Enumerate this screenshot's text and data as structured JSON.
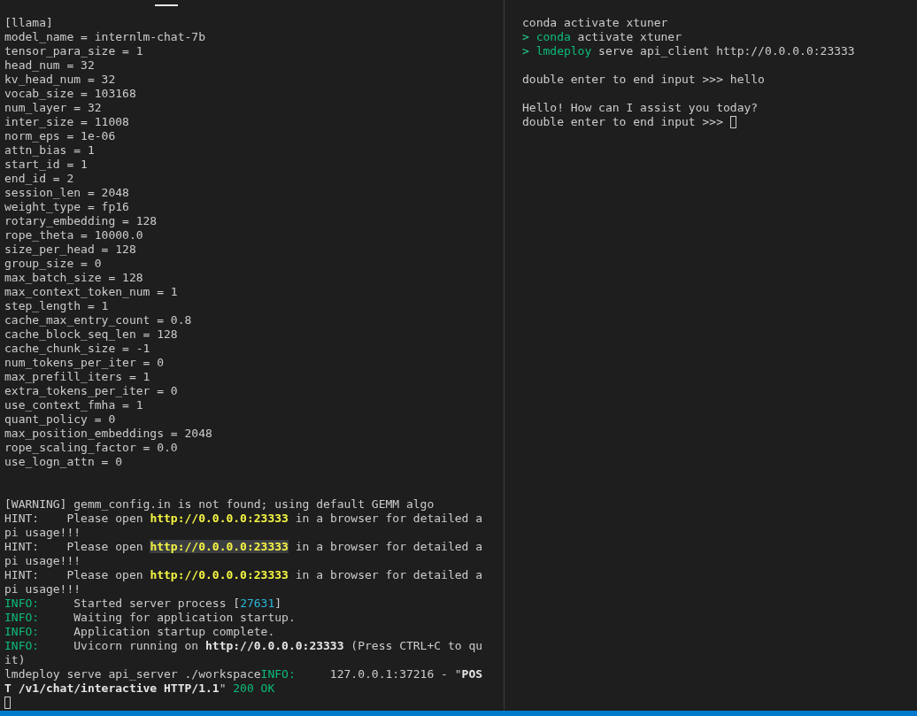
{
  "panes": [
    {
      "active_tab_indicator": true,
      "lines": [
        {
          "kind": "text",
          "segments": [
            {
              "text": "[llama]",
              "kind": "plain"
            }
          ]
        },
        {
          "kind": "text",
          "segments": [
            {
              "text": "model_name = internlm-chat-7b",
              "kind": "plain"
            }
          ]
        },
        {
          "kind": "text",
          "segments": [
            {
              "text": "tensor_para_size = 1",
              "kind": "plain"
            }
          ]
        },
        {
          "kind": "text",
          "segments": [
            {
              "text": "head_num = 32",
              "kind": "plain"
            }
          ]
        },
        {
          "kind": "text",
          "segments": [
            {
              "text": "kv_head_num = 32",
              "kind": "plain"
            }
          ]
        },
        {
          "kind": "text",
          "segments": [
            {
              "text": "vocab_size = 103168",
              "kind": "plain"
            }
          ]
        },
        {
          "kind": "text",
          "segments": [
            {
              "text": "num_layer = 32",
              "kind": "plain"
            }
          ]
        },
        {
          "kind": "text",
          "segments": [
            {
              "text": "inter_size = 11008",
              "kind": "plain"
            }
          ]
        },
        {
          "kind": "text",
          "segments": [
            {
              "text": "norm_eps = 1e-06",
              "kind": "plain"
            }
          ]
        },
        {
          "kind": "text",
          "segments": [
            {
              "text": "attn_bias = 1",
              "kind": "plain"
            }
          ]
        },
        {
          "kind": "text",
          "segments": [
            {
              "text": "start_id = 1",
              "kind": "plain"
            }
          ]
        },
        {
          "kind": "text",
          "segments": [
            {
              "text": "end_id = 2",
              "kind": "plain"
            }
          ]
        },
        {
          "kind": "text",
          "segments": [
            {
              "text": "session_len = 2048",
              "kind": "plain"
            }
          ]
        },
        {
          "kind": "text",
          "segments": [
            {
              "text": "weight_type = fp16",
              "kind": "plain"
            }
          ]
        },
        {
          "kind": "text",
          "segments": [
            {
              "text": "rotary_embedding = 128",
              "kind": "plain"
            }
          ]
        },
        {
          "kind": "text",
          "segments": [
            {
              "text": "rope_theta = 10000.0",
              "kind": "plain"
            }
          ]
        },
        {
          "kind": "text",
          "segments": [
            {
              "text": "size_per_head = 128",
              "kind": "plain"
            }
          ]
        },
        {
          "kind": "text",
          "segments": [
            {
              "text": "group_size = 0",
              "kind": "plain"
            }
          ]
        },
        {
          "kind": "text",
          "segments": [
            {
              "text": "max_batch_size = 128",
              "kind": "plain"
            }
          ]
        },
        {
          "kind": "text",
          "segments": [
            {
              "text": "max_context_token_num = 1",
              "kind": "plain"
            }
          ]
        },
        {
          "kind": "text",
          "segments": [
            {
              "text": "step_length = 1",
              "kind": "plain"
            }
          ]
        },
        {
          "kind": "text",
          "segments": [
            {
              "text": "cache_max_entry_count = 0.8",
              "kind": "plain"
            }
          ]
        },
        {
          "kind": "text",
          "segments": [
            {
              "text": "cache_block_seq_len = 128",
              "kind": "plain"
            }
          ]
        },
        {
          "kind": "text",
          "segments": [
            {
              "text": "cache_chunk_size = -1",
              "kind": "plain"
            }
          ]
        },
        {
          "kind": "text",
          "segments": [
            {
              "text": "num_tokens_per_iter = 0",
              "kind": "plain"
            }
          ]
        },
        {
          "kind": "text",
          "segments": [
            {
              "text": "max_prefill_iters = 1",
              "kind": "plain"
            }
          ]
        },
        {
          "kind": "text",
          "segments": [
            {
              "text": "extra_tokens_per_iter = 0",
              "kind": "plain"
            }
          ]
        },
        {
          "kind": "text",
          "segments": [
            {
              "text": "use_context_fmha = 1",
              "kind": "plain"
            }
          ]
        },
        {
          "kind": "text",
          "segments": [
            {
              "text": "quant_policy = 0",
              "kind": "plain"
            }
          ]
        },
        {
          "kind": "text",
          "segments": [
            {
              "text": "max_position_embeddings = 2048",
              "kind": "plain"
            }
          ]
        },
        {
          "kind": "text",
          "segments": [
            {
              "text": "rope_scaling_factor = 0.0",
              "kind": "plain"
            }
          ]
        },
        {
          "kind": "text",
          "segments": [
            {
              "text": "use_logn_attn = 0",
              "kind": "plain"
            }
          ]
        },
        {
          "kind": "blank"
        },
        {
          "kind": "blank"
        },
        {
          "kind": "text",
          "segments": [
            {
              "text": "[WARNING] gemm_config.in is not found; using default GEMM algo",
              "kind": "plain"
            }
          ]
        },
        {
          "kind": "text",
          "segments": [
            {
              "text": "HINT:    Please open ",
              "kind": "plain"
            },
            {
              "text": "http://0.0.0.0:23333",
              "kind": "url"
            },
            {
              "text": " in a browser for detailed a",
              "kind": "plain"
            }
          ]
        },
        {
          "kind": "text",
          "segments": [
            {
              "text": "pi usage!!!",
              "kind": "plain"
            }
          ]
        },
        {
          "kind": "text",
          "segments": [
            {
              "text": "HINT:    Please open ",
              "kind": "plain"
            },
            {
              "text": "http://0.0.0.0:23333",
              "kind": "url-selected"
            },
            {
              "text": " in a browser for detailed a",
              "kind": "plain"
            }
          ]
        },
        {
          "kind": "text",
          "segments": [
            {
              "text": "pi usage!!!",
              "kind": "plain"
            }
          ]
        },
        {
          "kind": "text",
          "segments": [
            {
              "text": "HINT:    Please open ",
              "kind": "plain"
            },
            {
              "text": "http://0.0.0.0:23333",
              "kind": "url"
            },
            {
              "text": " in a browser for detailed a",
              "kind": "plain"
            }
          ]
        },
        {
          "kind": "text",
          "segments": [
            {
              "text": "pi usage!!!",
              "kind": "plain"
            }
          ]
        },
        {
          "kind": "text",
          "segments": [
            {
              "text": "INFO:",
              "kind": "info"
            },
            {
              "text": "     Started server process [",
              "kind": "plain"
            },
            {
              "text": "27631",
              "kind": "number"
            },
            {
              "text": "]",
              "kind": "plain"
            }
          ]
        },
        {
          "kind": "text",
          "segments": [
            {
              "text": "INFO:",
              "kind": "info"
            },
            {
              "text": "     Waiting for application startup.",
              "kind": "plain"
            }
          ]
        },
        {
          "kind": "text",
          "segments": [
            {
              "text": "INFO:",
              "kind": "info"
            },
            {
              "text": "     Application startup complete.",
              "kind": "plain"
            }
          ]
        },
        {
          "kind": "text",
          "segments": [
            {
              "text": "INFO:",
              "kind": "info"
            },
            {
              "text": "     Uvicorn running on ",
              "kind": "plain"
            },
            {
              "text": "http://0.0.0.0:23333",
              "kind": "bold"
            },
            {
              "text": " (Press CTRL+C to qu",
              "kind": "plain"
            }
          ]
        },
        {
          "kind": "text",
          "segments": [
            {
              "text": "it)",
              "kind": "plain"
            }
          ]
        },
        {
          "kind": "text",
          "segments": [
            {
              "text": "lmdeploy serve api_server ./workspace",
              "kind": "plain"
            },
            {
              "text": "INFO:",
              "kind": "info"
            },
            {
              "text": "     127.0.0.1:37216 - \"",
              "kind": "plain"
            },
            {
              "text": "POS",
              "kind": "bold"
            }
          ]
        },
        {
          "kind": "text",
          "segments": [
            {
              "text": "T /v1/chat/interactive HTTP/1.1",
              "kind": "bold"
            },
            {
              "text": "\" ",
              "kind": "plain"
            },
            {
              "text": "200 OK",
              "kind": "info"
            }
          ]
        },
        {
          "kind": "cursor"
        }
      ]
    },
    {
      "active_tab_indicator": false,
      "lines": [
        {
          "kind": "text",
          "segments": [
            {
              "text": "conda activate xtuner",
              "kind": "plain"
            }
          ]
        },
        {
          "kind": "text",
          "segments": [
            {
              "text": "> ",
              "kind": "prompt"
            },
            {
              "text": "conda",
              "kind": "command"
            },
            {
              "text": " activate xtuner",
              "kind": "plain"
            }
          ]
        },
        {
          "kind": "text",
          "segments": [
            {
              "text": "> ",
              "kind": "prompt"
            },
            {
              "text": "lmdeploy",
              "kind": "command"
            },
            {
              "text": " serve api_client http://0.0.0.0:23333",
              "kind": "plain"
            }
          ]
        },
        {
          "kind": "blank"
        },
        {
          "kind": "text",
          "segments": [
            {
              "text": "double enter to end input >>> hello",
              "kind": "plain"
            }
          ]
        },
        {
          "kind": "blank"
        },
        {
          "kind": "text",
          "segments": [
            {
              "text": "Hello! How can I assist you today?",
              "kind": "plain"
            }
          ]
        },
        {
          "kind": "cursor",
          "segments": [
            {
              "text": "double enter to end input >>> ",
              "kind": "plain"
            }
          ]
        }
      ]
    }
  ]
}
